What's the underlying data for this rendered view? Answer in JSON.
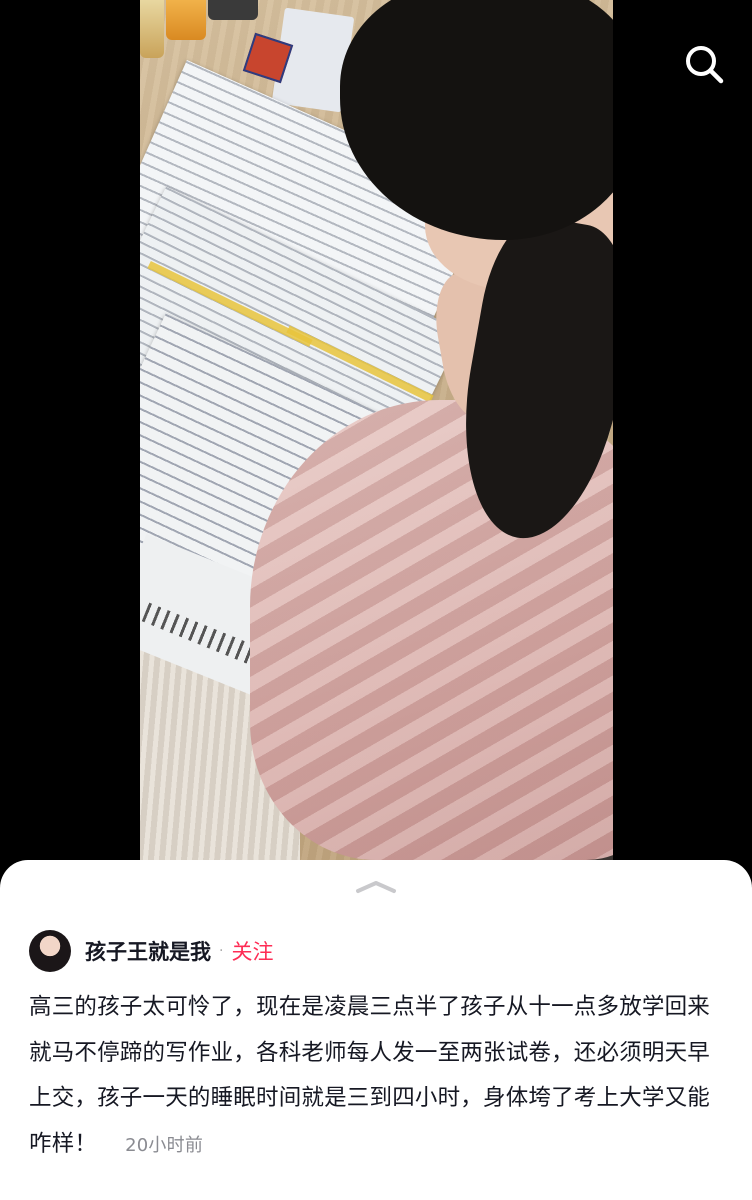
{
  "video": {
    "search_icon": "search-icon"
  },
  "panel": {
    "collapse_icon": "chevron-up-icon",
    "author": {
      "name": "孩子王就是我",
      "separator": "·",
      "follow_label": "关注"
    },
    "caption": "高三的孩子太可怜了，现在是凌晨三点半了孩子从十一点多放学回来就马不停蹄的写作业，各科老师每人发一至两张试卷，还必须明天早上交，孩子一天的睡眠时间就是三到四小时，身体垮了考上大学又能咋样！",
    "time": "20小时前"
  },
  "colors": {
    "follow": "#fe2c55",
    "text": "#161823",
    "meta": "#8a8b91"
  }
}
